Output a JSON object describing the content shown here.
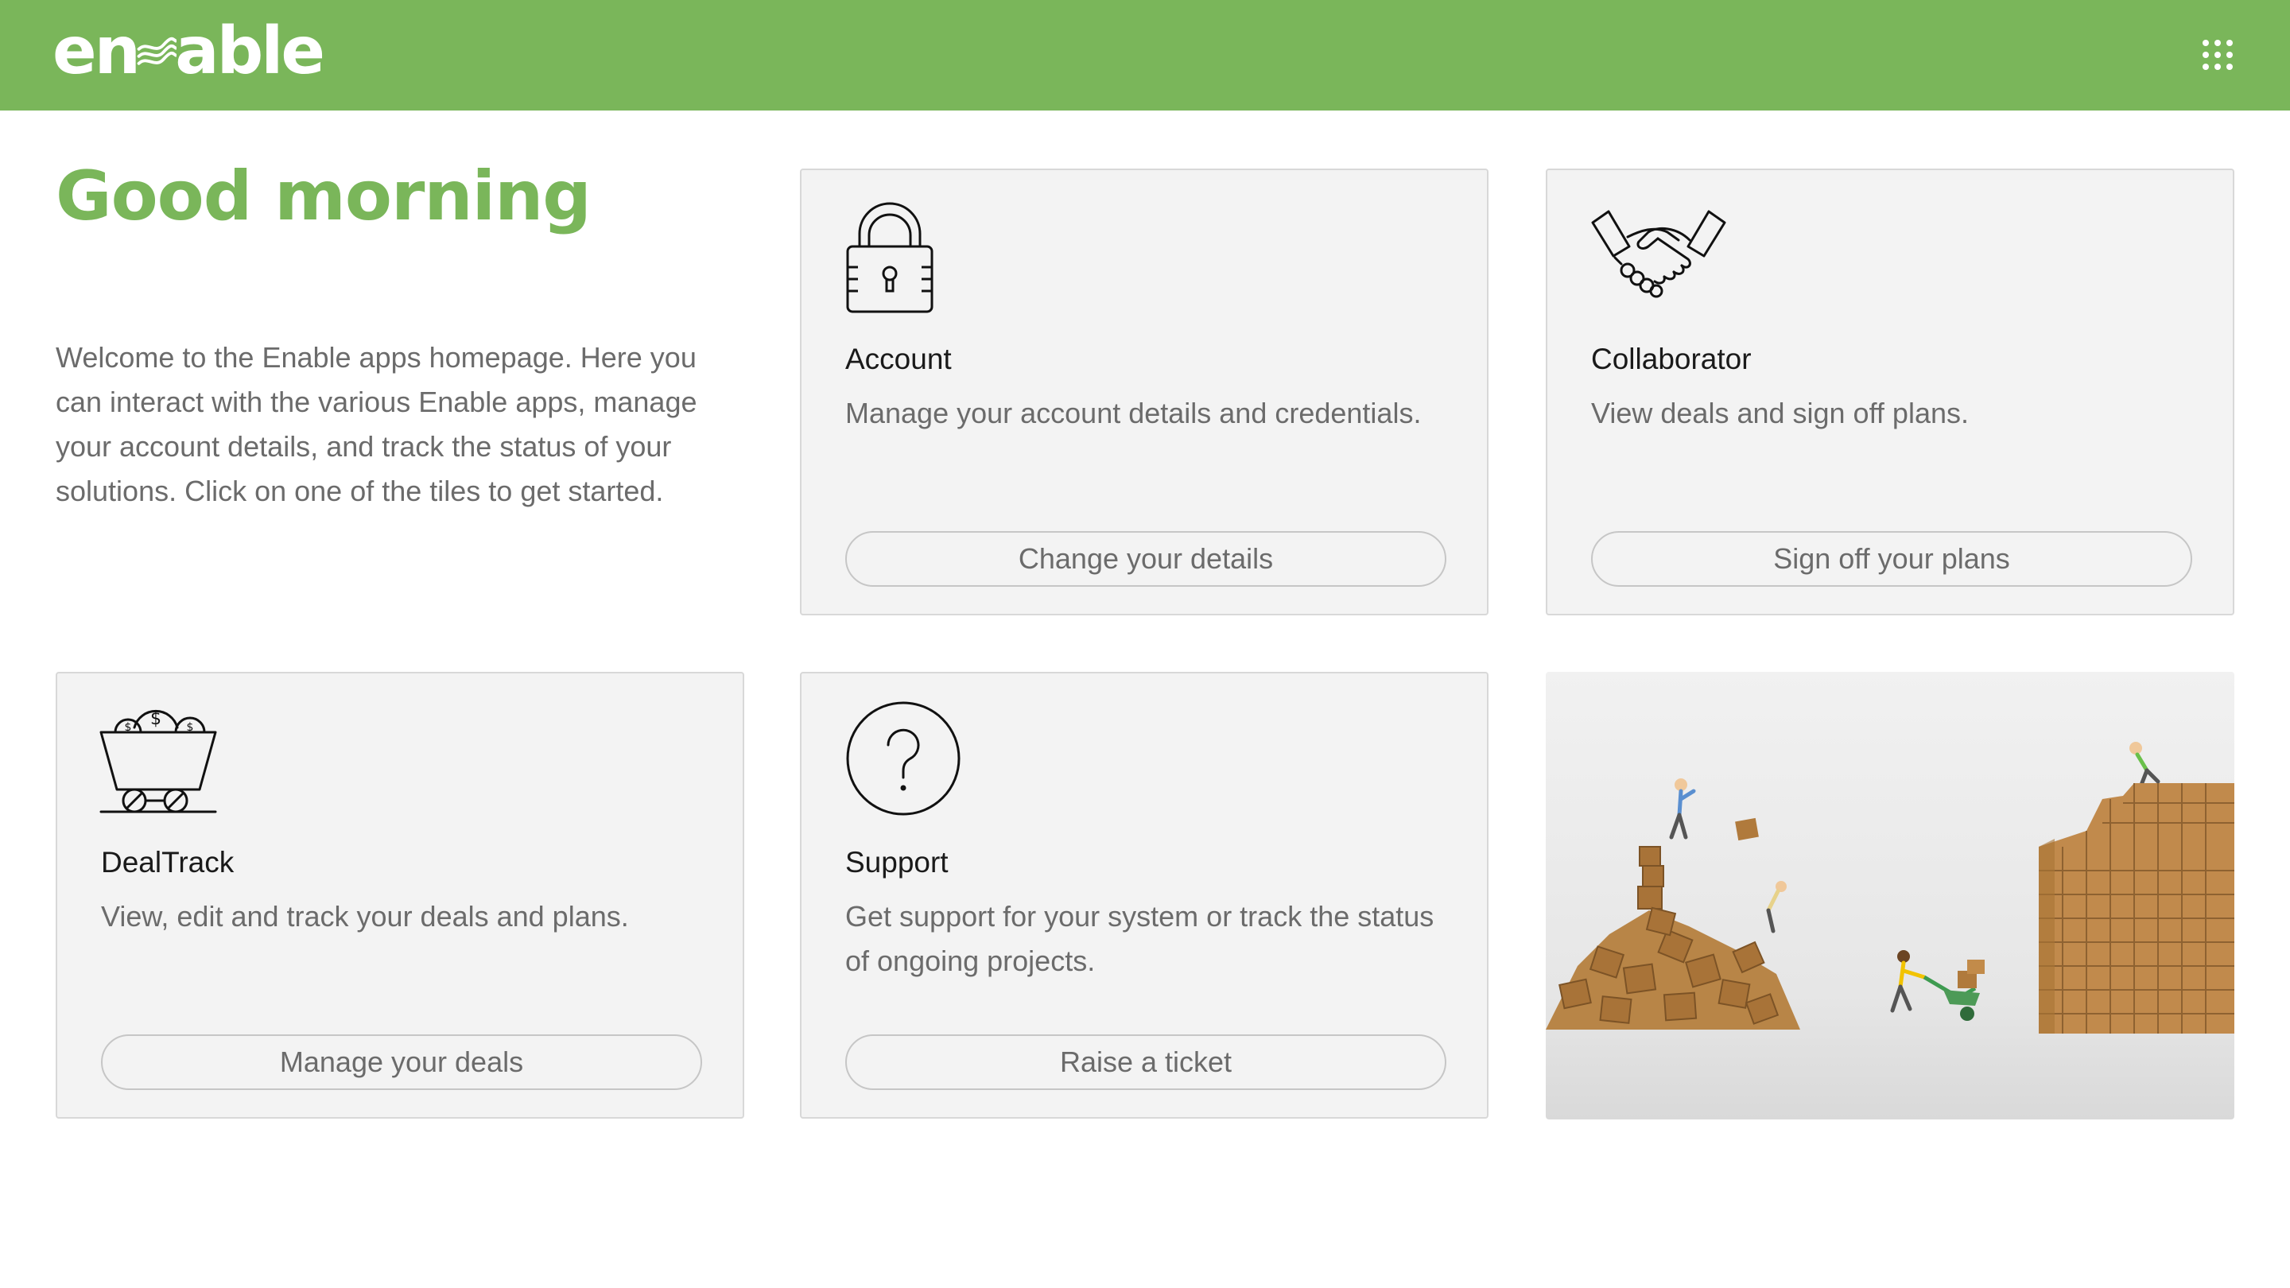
{
  "header": {
    "logo_text_left": "en",
    "logo_text_right": "able",
    "apps_icon": "apps-grid-icon"
  },
  "greeting": "Good morning",
  "intro": "Welcome to the Enable apps homepage. Here you can interact with the various Enable apps, manage your account details, and track the status of your solutions. Click on one of the tiles to get started.",
  "tiles": [
    {
      "icon": "padlock-icon",
      "title": "Account",
      "description": "Manage your account details and credentials.",
      "button": "Change your details"
    },
    {
      "icon": "handshake-icon",
      "title": "Collaborator",
      "description": "View deals and sign off plans.",
      "button": "Sign off your plans"
    },
    {
      "icon": "money-cart-icon",
      "title": "DealTrack",
      "description": "View, edit and track your deals and plans.",
      "button": "Manage your deals"
    },
    {
      "icon": "question-mark-icon",
      "title": "Support",
      "description": "Get support for your system or track the status of ongoing projects.",
      "button": "Raise a ticket"
    }
  ],
  "colors": {
    "brand_green": "#7ab65a",
    "tile_background": "#f3f3f3",
    "text_grey": "#6b6b6b"
  }
}
